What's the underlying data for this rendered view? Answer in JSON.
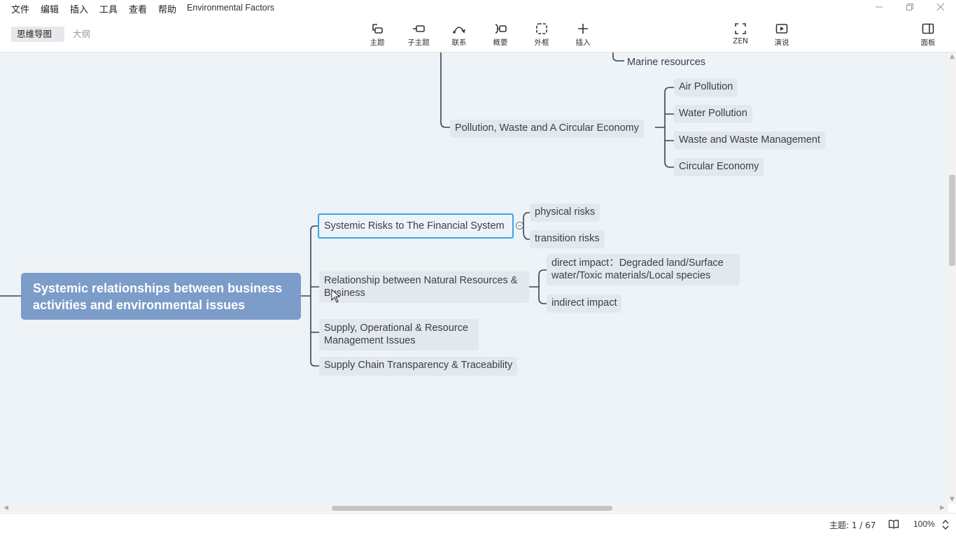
{
  "menubar": {
    "items": [
      "文件",
      "编辑",
      "插入",
      "工具",
      "查看",
      "帮助"
    ],
    "title": "Environmental Factors"
  },
  "toolbar": {
    "view_tabs": {
      "mindmap": "思维导图",
      "outline": "大纲"
    },
    "tools": {
      "topic": "主题",
      "subtopic": "子主题",
      "relationship": "联系",
      "summary": "概要",
      "boundary": "外框",
      "insert": "插入",
      "zen": "ZEN",
      "present": "演说",
      "panel": "面板"
    }
  },
  "mindmap": {
    "central": "Systemic relationships between business activities and environmental issues",
    "marine": "Marine resources",
    "pollution": {
      "label": "Pollution, Waste and A Circular Economy",
      "children": [
        "Air Pollution",
        "Water Pollution",
        "Waste and Waste Management",
        "Circular Economy"
      ]
    },
    "systemic": {
      "label": "Systemic Risks to The Financial System",
      "children": [
        "physical risks",
        "transition risks"
      ]
    },
    "relationship": {
      "label_line1": "Relationship between Natural Resources &",
      "label_line2": "Business",
      "direct_line1": "direct impact：Degraded land/Surface",
      "direct_line2": "water/Toxic materials/Local species",
      "indirect": "indirect impact"
    },
    "supply_ops": {
      "line1": "Supply, Operational & Resource",
      "line2": "Management Issues"
    },
    "supply_chain": "Supply Chain Transparency & Traceability"
  },
  "status": {
    "topic_count": "主题: 1 / 67",
    "zoom": "100%"
  },
  "colors": {
    "central_fill": "#7c9cc9",
    "selection": "#3ba3e6",
    "canvas": "#eef3f7",
    "node_fill": "#e3e8ee",
    "line": "#3a4350"
  }
}
